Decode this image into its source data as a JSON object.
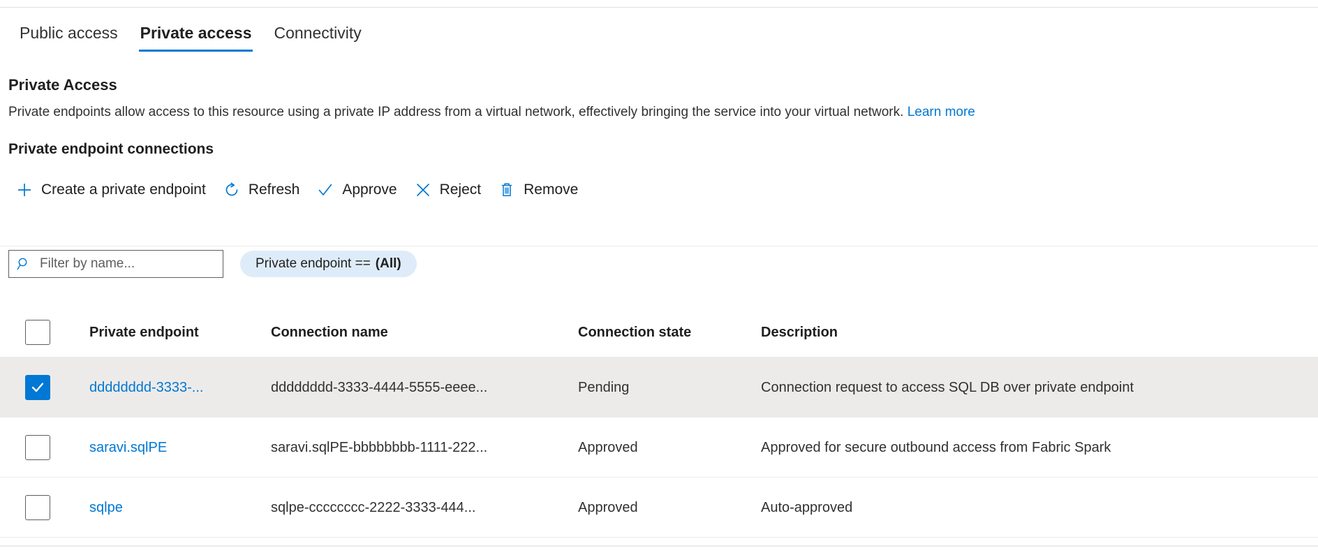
{
  "tabs": [
    {
      "label": "Public access",
      "active": false
    },
    {
      "label": "Private access",
      "active": true
    },
    {
      "label": "Connectivity",
      "active": false
    }
  ],
  "section": {
    "title": "Private Access",
    "description": "Private endpoints allow access to this resource using a private IP address from a virtual network, effectively bringing the service into your virtual network.",
    "learn_more": "Learn more",
    "subsection_title": "Private endpoint connections"
  },
  "commandbar": [
    {
      "label": "Create a private endpoint",
      "icon": "plus-icon"
    },
    {
      "label": "Refresh",
      "icon": "refresh-icon"
    },
    {
      "label": "Approve",
      "icon": "checkmark-icon"
    },
    {
      "label": "Reject",
      "icon": "cross-icon"
    },
    {
      "label": "Remove",
      "icon": "trash-icon"
    }
  ],
  "filters": {
    "search_placeholder": "Filter by name...",
    "search_value": "",
    "search_icon": "search-icon",
    "pill_label": "Private endpoint  ==",
    "pill_value": "(All)"
  },
  "table": {
    "columns": [
      "Private endpoint",
      "Connection name",
      "Connection state",
      "Description"
    ],
    "select_all_checked": false,
    "rows": [
      {
        "selected": true,
        "endpoint": "dddddddd-3333-...",
        "connection_name": "dddddddd-3333-4444-5555-eeee...",
        "state": "Pending",
        "description": "Connection request to access SQL DB over private endpoint"
      },
      {
        "selected": false,
        "endpoint": "saravi.sqlPE",
        "connection_name": "saravi.sqlPE-bbbbbbbb-1111-222...",
        "state": "Approved",
        "description": "Approved for secure outbound access from Fabric Spark"
      },
      {
        "selected": false,
        "endpoint": "sqlpe",
        "connection_name": "sqlpe-cccccccc-2222-3333-444...",
        "state": "Approved",
        "description": "Auto-approved"
      }
    ]
  },
  "colors": {
    "accent": "#0078d4",
    "selected_row_bg": "#edebe9",
    "pill_bg": "#deecf9"
  }
}
